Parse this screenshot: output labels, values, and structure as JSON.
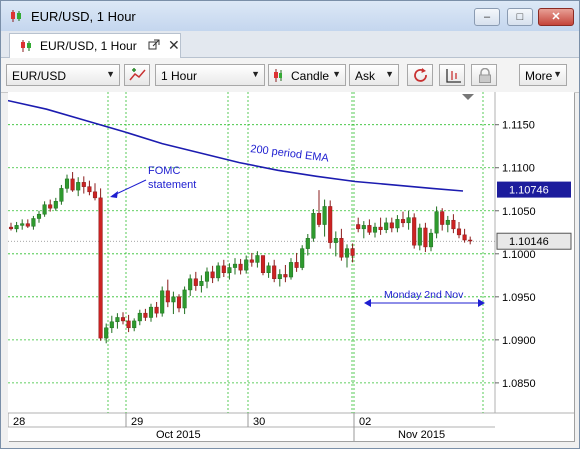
{
  "window": {
    "title": "EUR/USD, 1 Hour",
    "minimize_label": "–",
    "maximize_label": "□",
    "close_label": "✕"
  },
  "tab": {
    "label": "EUR/USD, 1 Hour",
    "popout_icon": "popout-icon",
    "close_label": "✕"
  },
  "toolbar": {
    "symbol": "EUR/USD",
    "timeframe": "1 Hour",
    "chart_style": "Candle",
    "price_side": "Ask",
    "more_label": "More",
    "icons": [
      "add-indicator-icon",
      "refresh-icon",
      "drawing-icon",
      "lock-icon"
    ]
  },
  "colors": {
    "up": "#2e9a2e",
    "down": "#cc2222",
    "grid": "#2fbf2f",
    "ema": "#1c1cb0",
    "annot": "#1e1ed0"
  },
  "chart_data": {
    "type": "candlestick",
    "ylim": [
      1.0815,
      1.1188
    ],
    "y_ticks": [
      "1.1150",
      "1.1100",
      "1.1050",
      "1.1000",
      "1.0950",
      "1.0900",
      "1.0850"
    ],
    "x_day_labels": [
      "28",
      "29",
      "30",
      "02"
    ],
    "x_month_labels": [
      "Oct 2015",
      "Nov 2015"
    ],
    "price_tags": [
      "1.10746",
      "1.10146"
    ],
    "annotations": {
      "fomc": [
        "FOMC",
        "statement"
      ],
      "ema": "200 period EMA",
      "monday": "Monday 2nd Nov"
    },
    "ema_series": [
      [
        0,
        1.1178
      ],
      [
        10,
        1.1168
      ],
      [
        20,
        1.1155
      ],
      [
        30,
        1.1142
      ],
      [
        40,
        1.1128
      ],
      [
        50,
        1.1117
      ],
      [
        60,
        1.1106
      ],
      [
        70,
        1.1097
      ],
      [
        80,
        1.109
      ],
      [
        90,
        1.1084
      ],
      [
        100,
        1.108
      ],
      [
        110,
        1.1076
      ],
      [
        118,
        1.1073
      ]
    ],
    "candles": [
      [
        1.1031,
        1.1036,
        1.1027,
        1.1029
      ],
      [
        1.1029,
        1.1037,
        1.1025,
        1.1033
      ],
      [
        1.1033,
        1.104,
        1.1028,
        1.1035
      ],
      [
        1.1035,
        1.104,
        1.103,
        1.1032
      ],
      [
        1.1032,
        1.1044,
        1.1028,
        1.1041
      ],
      [
        1.1041,
        1.105,
        1.1036,
        1.1046
      ],
      [
        1.1046,
        1.1061,
        1.1043,
        1.1057
      ],
      [
        1.1057,
        1.1063,
        1.1049,
        1.1053
      ],
      [
        1.1053,
        1.1065,
        1.105,
        1.1061
      ],
      [
        1.1061,
        1.108,
        1.1057,
        1.1076
      ],
      [
        1.1076,
        1.1092,
        1.1071,
        1.1087
      ],
      [
        1.1087,
        1.1095,
        1.1072,
        1.1074
      ],
      [
        1.1074,
        1.1089,
        1.1067,
        1.1083
      ],
      [
        1.1083,
        1.109,
        1.107,
        1.1078
      ],
      [
        1.1078,
        1.1085,
        1.1068,
        1.1072
      ],
      [
        1.1072,
        1.1082,
        1.1062,
        1.1065
      ],
      [
        1.1065,
        1.1076,
        1.0899,
        1.0902
      ],
      [
        1.0902,
        1.0919,
        1.0896,
        1.0914
      ],
      [
        1.0914,
        1.0928,
        1.0908,
        1.0921
      ],
      [
        1.0921,
        1.0931,
        1.0913,
        1.0926
      ],
      [
        1.0926,
        1.0932,
        1.0918,
        1.0922
      ],
      [
        1.0922,
        1.0929,
        1.0909,
        1.0914
      ],
      [
        1.0914,
        1.0925,
        1.091,
        1.0922
      ],
      [
        1.0922,
        1.0935,
        1.0917,
        1.0931
      ],
      [
        1.0931,
        1.0936,
        1.0922,
        1.0926
      ],
      [
        1.0926,
        1.0942,
        1.0921,
        1.0938
      ],
      [
        1.0938,
        1.0944,
        1.0926,
        1.0931
      ],
      [
        1.0931,
        1.0962,
        1.0927,
        1.0957
      ],
      [
        1.0957,
        1.097,
        1.0938,
        1.0944
      ],
      [
        1.0944,
        1.0956,
        1.093,
        1.095
      ],
      [
        1.095,
        1.0953,
        1.0932,
        1.0937
      ],
      [
        1.0937,
        1.0962,
        1.093,
        1.0958
      ],
      [
        1.0958,
        1.0976,
        1.0951,
        1.0971
      ],
      [
        1.0971,
        1.0979,
        1.0957,
        1.0963
      ],
      [
        1.0963,
        1.0975,
        1.0955,
        1.0968
      ],
      [
        1.0968,
        1.0984,
        1.096,
        1.0979
      ],
      [
        1.0979,
        1.0986,
        1.0966,
        1.0972
      ],
      [
        1.0972,
        1.099,
        1.0968,
        1.0986
      ],
      [
        1.0986,
        1.0993,
        1.0973,
        1.0978
      ],
      [
        1.0978,
        1.0989,
        1.097,
        1.0984
      ],
      [
        1.0984,
        1.0995,
        1.0976,
        1.0988
      ],
      [
        1.0988,
        1.0994,
        1.0976,
        1.0981
      ],
      [
        1.0981,
        1.0998,
        1.0977,
        1.0993
      ],
      [
        1.0993,
        1.1001,
        1.0985,
        1.099
      ],
      [
        1.099,
        1.1003,
        1.0984,
        1.0998
      ],
      [
        1.0998,
        1.0998,
        1.0975,
        1.0978
      ],
      [
        1.0978,
        1.099,
        1.0972,
        1.0986
      ],
      [
        1.0986,
        1.0993,
        1.0967,
        1.0971
      ],
      [
        1.0971,
        1.0982,
        1.0962,
        1.0976
      ],
      [
        1.0976,
        1.0987,
        1.0967,
        1.0973
      ],
      [
        1.0973,
        1.0995,
        1.097,
        1.099
      ],
      [
        1.099,
        1.1001,
        1.0979,
        1.0984
      ],
      [
        1.0984,
        1.101,
        1.0981,
        1.1006
      ],
      [
        1.1006,
        1.1023,
        1.0998,
        1.1018
      ],
      [
        1.1018,
        1.1052,
        1.1014,
        1.1047
      ],
      [
        1.1047,
        1.1074,
        1.1031,
        1.1034
      ],
      [
        1.1034,
        1.1063,
        1.102,
        1.1055
      ],
      [
        1.1055,
        1.1062,
        1.1006,
        1.1013
      ],
      [
        1.1013,
        1.1026,
        1.0997,
        1.1018
      ],
      [
        1.1018,
        1.1029,
        1.0992,
        1.0996
      ],
      [
        1.0996,
        1.1011,
        1.0984,
        1.1006
      ],
      [
        1.1006,
        1.1012,
        1.099,
        1.0998
      ],
      [
        1.1034,
        1.1042,
        1.1025,
        1.1029
      ],
      [
        1.1029,
        1.1038,
        1.1018,
        1.1033
      ],
      [
        1.1033,
        1.104,
        1.1022,
        1.1025
      ],
      [
        1.1025,
        1.1036,
        1.1019,
        1.1031
      ],
      [
        1.1031,
        1.1042,
        1.1022,
        1.1028
      ],
      [
        1.1028,
        1.1042,
        1.1024,
        1.1036
      ],
      [
        1.1036,
        1.1042,
        1.1025,
        1.103
      ],
      [
        1.103,
        1.1045,
        1.1025,
        1.104
      ],
      [
        1.104,
        1.1049,
        1.1031,
        1.1036
      ],
      [
        1.1036,
        1.105,
        1.1028,
        1.1042
      ],
      [
        1.1042,
        1.1047,
        1.1006,
        1.101
      ],
      [
        1.101,
        1.1035,
        1.1004,
        1.103
      ],
      [
        1.103,
        1.1036,
        1.1002,
        1.1008
      ],
      [
        1.1008,
        1.1029,
        1.1003,
        1.1024
      ],
      [
        1.1024,
        1.1055,
        1.1018,
        1.1049
      ],
      [
        1.1049,
        1.1053,
        1.1027,
        1.1034
      ],
      [
        1.1034,
        1.1044,
        1.1025,
        1.1039
      ],
      [
        1.1039,
        1.1046,
        1.1024,
        1.1029
      ],
      [
        1.1029,
        1.1037,
        1.1018,
        1.1022
      ],
      [
        1.1022,
        1.1029,
        1.1013,
        1.1016
      ],
      [
        1.1016,
        1.102,
        1.1011,
        1.1015
      ]
    ]
  }
}
